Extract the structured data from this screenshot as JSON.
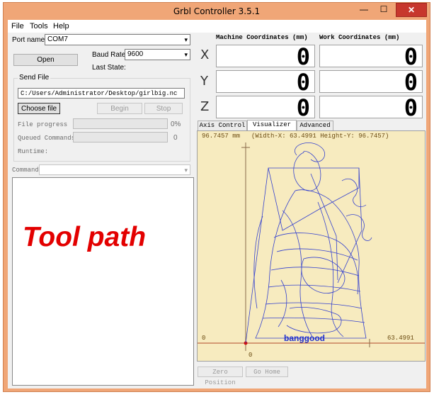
{
  "window": {
    "title": "Grbl Controller 3.5.1",
    "min_label": "—",
    "max_label": "☐",
    "close_label": "✕"
  },
  "menu": {
    "items": [
      "File",
      "Tools",
      "Help"
    ]
  },
  "port": {
    "label": "Port name",
    "value": "COM7",
    "open_button": "Open"
  },
  "baud": {
    "label": "Baud Rate",
    "value": "9600"
  },
  "state": {
    "label": "Last State:"
  },
  "send_file": {
    "group_label": "Send File",
    "path": "C:/Users/Administrator/Desktop/girlbig.nc",
    "choose_button": "Choose file",
    "begin_button": "Begin",
    "stop_button": "Stop",
    "progress_label": "File progress",
    "progress_value": "0%",
    "progress_fraction": 0,
    "queued_label": "Queued Commands",
    "queued_value": "0",
    "runtime_label": "Runtime:"
  },
  "command": {
    "label": "Command",
    "value": ""
  },
  "overlay": {
    "text": "Tool path",
    "color": "#e30000"
  },
  "coords": {
    "machine_label": "Machine Coordinates (mm)",
    "work_label": "Work Coordinates (mm)",
    "axes": [
      {
        "axis": "X",
        "machine": "0",
        "work": "0"
      },
      {
        "axis": "Y",
        "machine": "0",
        "work": "0"
      },
      {
        "axis": "Z",
        "machine": "0",
        "work": "0"
      }
    ]
  },
  "tabs": [
    "Axis Control",
    "Visualizer",
    "Advanced"
  ],
  "visualizer": {
    "top_left": "96.7457 mm",
    "dims": "(Width-X: 63.4991  Height-Y: 96.7457)",
    "origin_left": "0",
    "origin_bottom": "0",
    "right_value": "63.4991",
    "watermark": "banggood",
    "bg_color": "#f7ebbf",
    "path_color": "#1f2fd0"
  },
  "bottom": {
    "zero_button": "Zero Position",
    "home_button": "Go Home"
  }
}
